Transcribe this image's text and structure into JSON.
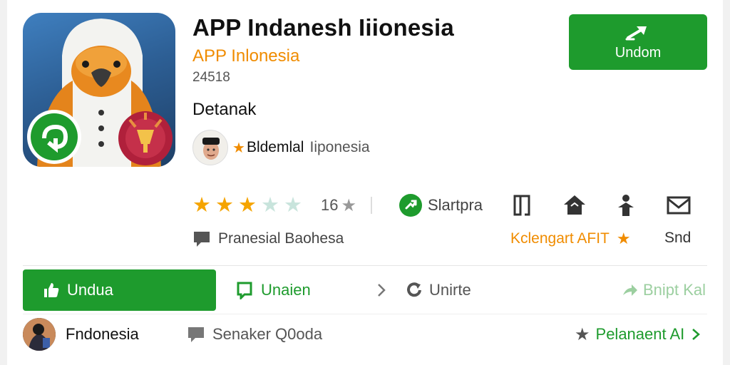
{
  "app": {
    "title": "APP Indanesh Iiionesia",
    "developer": "APP Inlonesia",
    "id": "24518",
    "section": "Detanak",
    "uploader_name": "Bldemlal",
    "uploader_region": "Iiponesia"
  },
  "install_button": {
    "label": "Undom"
  },
  "ratings": {
    "value": 3.5,
    "max": 5,
    "count": "16",
    "star_char": "★",
    "star_color": "#f5a400"
  },
  "actions": {
    "share_label": "Slartpra",
    "review_label": "Pranesial Baohesa",
    "category_label": "Kclengart AFIT",
    "send_label": "Snd"
  },
  "tabs": {
    "primary": "Undua",
    "second": "Unaien",
    "third": "Unirte",
    "fourth": "Bnipt Kal"
  },
  "bottom_row": {
    "user": "Fndonesia",
    "secondary": "Senaker Q0oda",
    "link": "Pelanaent AI"
  },
  "colors": {
    "accent_green": "#1e9b2d",
    "accent_orange": "#f08c00",
    "muted_green": "#9ccfa0"
  }
}
